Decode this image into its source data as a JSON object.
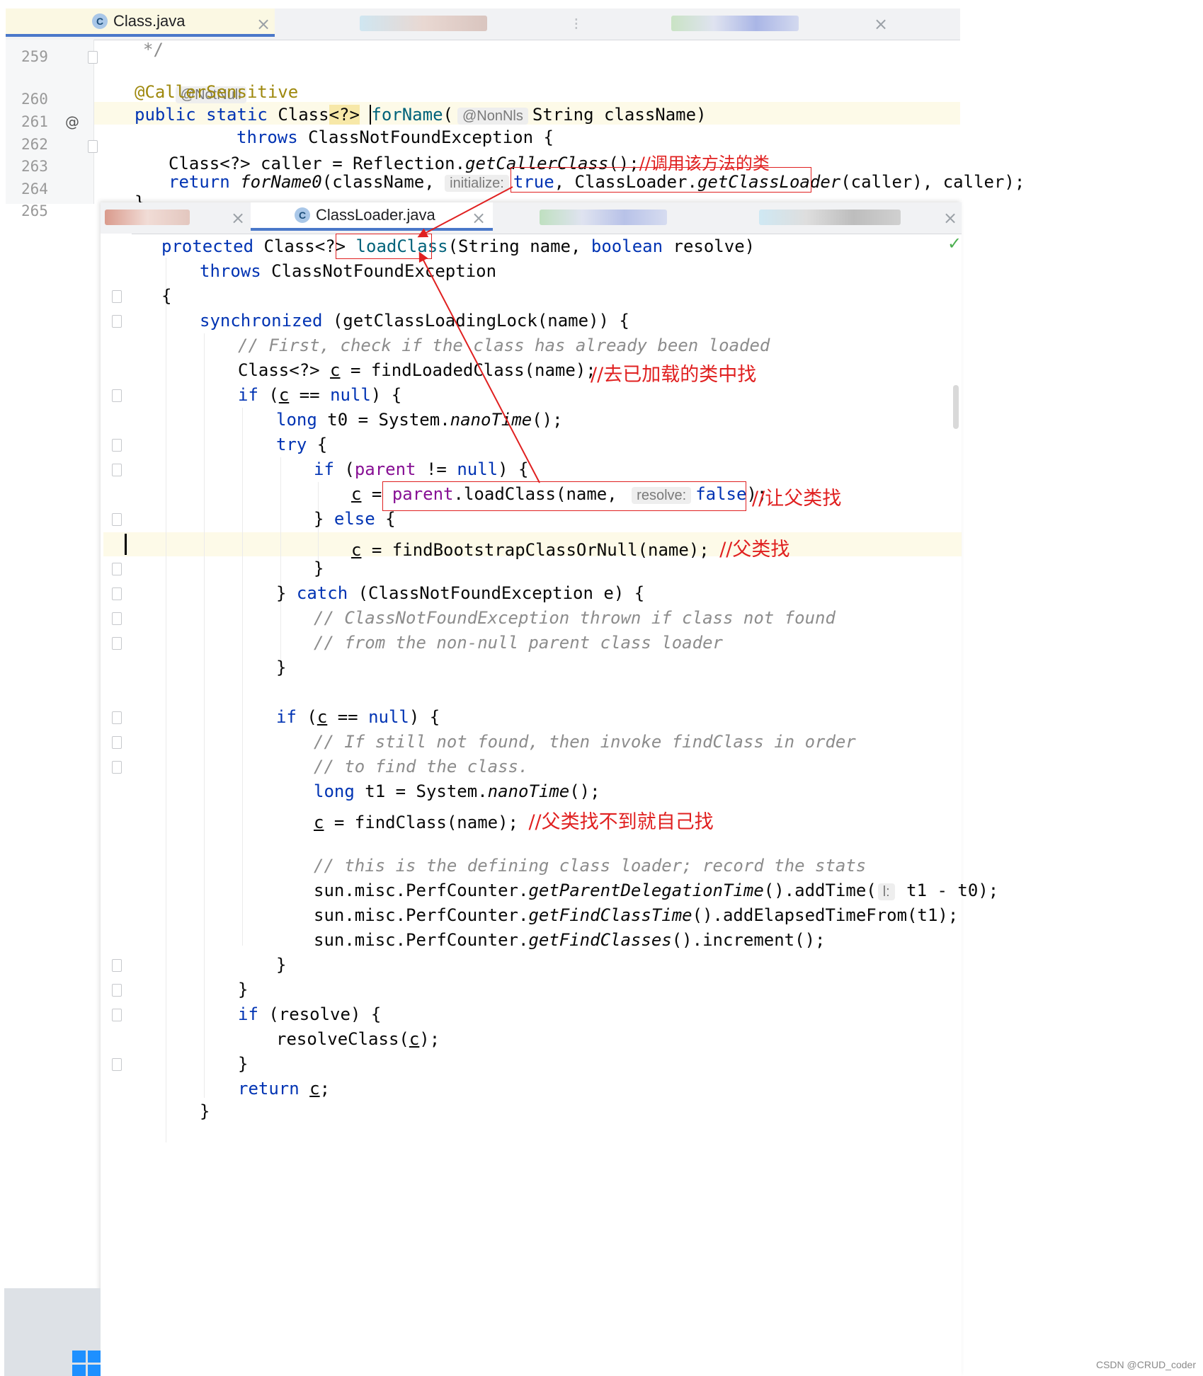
{
  "top_editor": {
    "tab_active": "Class.java",
    "tab_icon": "C",
    "lines": {
      "n259": "259",
      "c259": "*/",
      "c259b": "@NotNull",
      "n260": "260",
      "c260": "@CallerSensitive",
      "n261": "261",
      "gutter261": "@",
      "n262": "262",
      "n263": "263",
      "n264": "264",
      "n265": "265",
      "c261_public": "public",
      "c261_static": "static",
      "c261_class": "Class",
      "c261_generic": "<?>",
      "c261_forname": "forName",
      "c261_open": "(",
      "c261_hint": "@NonNls",
      "c261_rest": "String className)",
      "c262_throws": "throws",
      "c262_rest": " ClassNotFoundException {",
      "c263_pre": "Class<?> caller = Reflection.",
      "c263_call": "getCallerClass",
      "c263_post": "();",
      "c263_note": "//调用该方法的类",
      "c264_return": "return",
      "c264_call": "forName0",
      "c264_args": "(className, ",
      "c264_hint": "initialize:",
      "c264_true": "true",
      "c264_comma": ",",
      "c264_loader_pre": "ClassLoader.",
      "c264_loader_call": "getClassLoader",
      "c264_loader_post": "(caller)",
      "c264_tail": " caller);",
      "c265": "}"
    }
  },
  "bottom_editor": {
    "tab_active": "ClassLoader.java",
    "tab_icon": "C",
    "l1_protected": "protected",
    "l1_class": " Class<?> ",
    "l1_fn": "loadClass",
    "l1_a": "(String name, ",
    "l1_bool": "boolean",
    "l1_b": " resolve)",
    "l2_throws": "throws",
    "l2_rest": " ClassNotFoundException",
    "l3": "{",
    "l4_sync": "synchronized",
    "l4_rest": " (getClassLoadingLock(name)) {",
    "l5": "// First, check if the class has already been loaded",
    "l6_pre": "Class<?> ",
    "l6_c": "c",
    "l6_rest": " = findLoadedClass(name);",
    "l6_note": "//去已加载的类中找",
    "l7_if": "if",
    "l7_a": " (",
    "l7_c": "c",
    "l7_b": " == ",
    "l7_null": "null",
    "l7_rest": ") {",
    "l8_long": "long",
    "l8_a": " t0 = System.",
    "l8_call": "nanoTime",
    "l8_b": "();",
    "l9_try": "try",
    "l9_b": " {",
    "l10_if": "if",
    "l10_a": " (",
    "l10_parent": "parent",
    "l10_b": " != ",
    "l10_null": "null",
    "l10_c": ") {",
    "l11_c": "c",
    "l11_eq": " = ",
    "l11_parent": "parent",
    "l11_call": ".loadClass(name, ",
    "l11_hint": "resolve:",
    "l11_false": "false",
    "l11_end": ");",
    "l11_note": "//让父类找",
    "l12_a": "} ",
    "l12_else": "else",
    "l12_b": " {",
    "l13_c": "c",
    "l13_rest": " = findBootstrapClassOrNull(name);",
    "l13_note": "//父类找",
    "l14": "}",
    "l15_a": "} ",
    "l15_catch": "catch",
    "l15_b": " (ClassNotFoundException e) {",
    "l16": "// ClassNotFoundException thrown if class not found",
    "l17": "// from the non-null parent class loader",
    "l18": "}",
    "l20_if": "if",
    "l20_a": " (",
    "l20_c": "c",
    "l20_b": " == ",
    "l20_null": "null",
    "l20_rest": ") {",
    "l21": "// If still not found, then invoke findClass in order",
    "l22": "// to find the class.",
    "l23_long": "long",
    "l23_a": " t1 = System.",
    "l23_call": "nanoTime",
    "l23_b": "();",
    "l24_c": "c",
    "l24_rest": " = findClass(name); ",
    "l24_note": "//父类找不到就自己找",
    "l26": "// this is the defining class loader; record the stats",
    "l27_a": "sun.misc.PerfCounter.",
    "l27_call": "getParentDelegationTime",
    "l27_b": "().addTime(",
    "l27_hint": "l:",
    "l27_c": " t1 - t0);",
    "l28_a": "sun.misc.PerfCounter.",
    "l28_call": "getFindClassTime",
    "l28_b": "().addElapsedTimeFrom(t1);",
    "l29_a": "sun.misc.PerfCounter.",
    "l29_call": "getFindClasses",
    "l29_b": "().increment();",
    "l30": "}",
    "l31": "}",
    "l32_if": "if",
    "l32_rest": " (resolve) {",
    "l33_a": "resolveClass(",
    "l33_c": "c",
    "l33_b": ");",
    "l34": "}",
    "l35_return": "return",
    "l35_sp": " ",
    "l35_c": "c",
    "l35_semi": ";",
    "l36": "}"
  },
  "watermark": "CSDN @CRUD_coder",
  "colors": {
    "keyword": "#0033b3",
    "method": "#00627a",
    "comment": "#8c8c8c",
    "annotation": "#9e880d",
    "field": "#871094",
    "note": "#e02020"
  }
}
